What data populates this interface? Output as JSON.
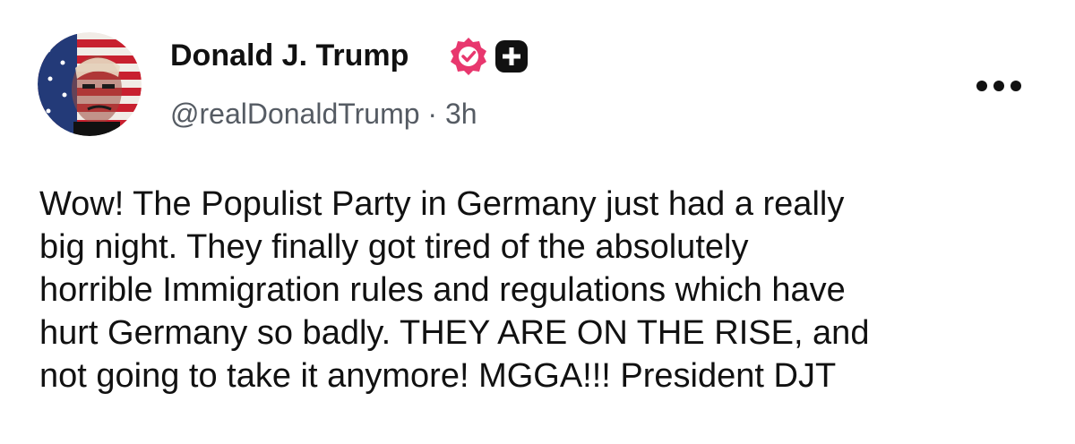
{
  "post": {
    "author": {
      "name": "Donald J. Trump",
      "handle": "@realDonaldTrump",
      "separator": "·",
      "time": "3h",
      "avatar_icon": "avatar-flag-portrait",
      "verified_icon": "verified-badge-icon",
      "plus_icon": "plus-badge-icon"
    },
    "more_icon": "more-options-icon",
    "text": "Wow! The Populist Party in Germany just had a really\nbig night. They finally got tired of the absolutely\nhorrible Immigration rules and regulations which have\nhurt Germany so badly. THEY ARE ON THE RISE, and\nnot going to take it anymore! MGGA!!! President DJT",
    "colors": {
      "text": "#111111",
      "secondary": "#555b63",
      "verified": "#e8376e",
      "flag_red": "#c8202f",
      "flag_blue": "#233a78"
    }
  }
}
